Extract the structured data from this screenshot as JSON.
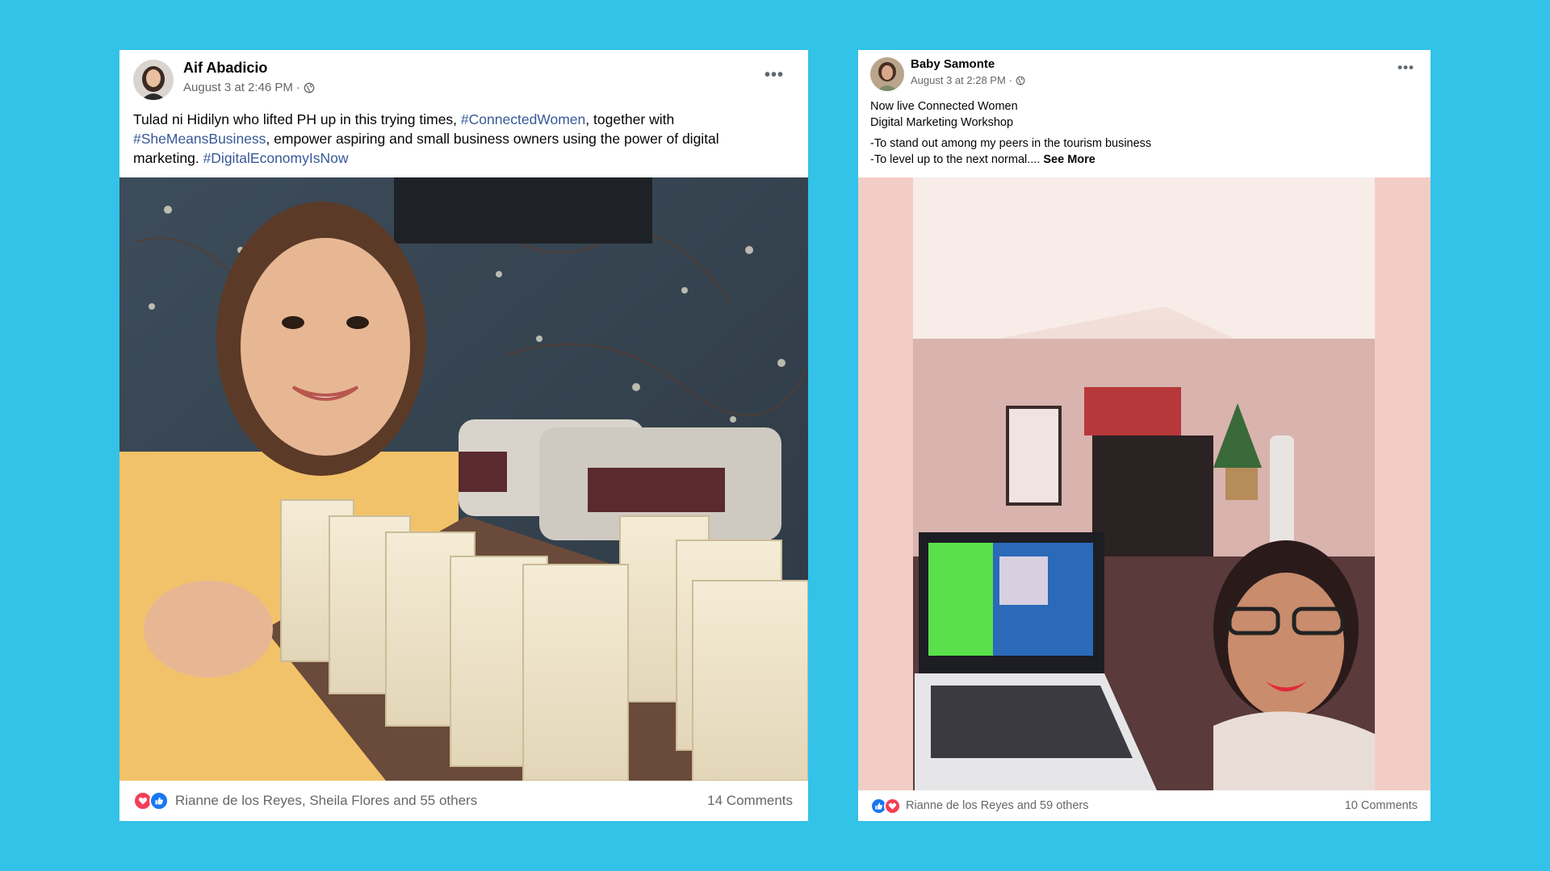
{
  "post1": {
    "author": "Aif Abadicio",
    "timestamp": "August 3 at 2:46 PM",
    "separator": "·",
    "audience_icon": "globe-icon",
    "text_1": "Tulad ni Hidilyn who lifted PH up in this trying times, ",
    "hashtag_1": "#ConnectedWomen",
    "text_2": ", together with ",
    "hashtag_2": "#SheMeansBusiness",
    "text_3": ", empower aspiring and small business owners using the power of digital marketing. ",
    "hashtag_3": "#DigitalEconomyIsNow",
    "reactions": [
      "love-reaction-icon",
      "like-reaction-icon"
    ],
    "reaction_text": "Rianne de los Reyes, Sheila Flores and 55 others",
    "comments": "14 Comments"
  },
  "post2": {
    "author": "Baby Samonte",
    "timestamp": "August 3 at 2:28 PM",
    "separator": "·",
    "audience_icon": "globe-icon",
    "line_1": "Now live Connected Women",
    "line_2": "Digital Marketing Workshop",
    "line_3": "-To stand out among my peers in the tourism business",
    "line_4": "-To level up to the next normal....",
    "see_more": "See More",
    "reactions": [
      "like-reaction-icon",
      "love-reaction-icon"
    ],
    "reaction_text": "Rianne de los Reyes and 59 others",
    "comments": "10 Comments"
  },
  "colors": {
    "background": "#33c2e8",
    "hashtag": "#385898",
    "like": "#1877f2",
    "love": "#f33e58",
    "secondary_text": "#65676b"
  }
}
